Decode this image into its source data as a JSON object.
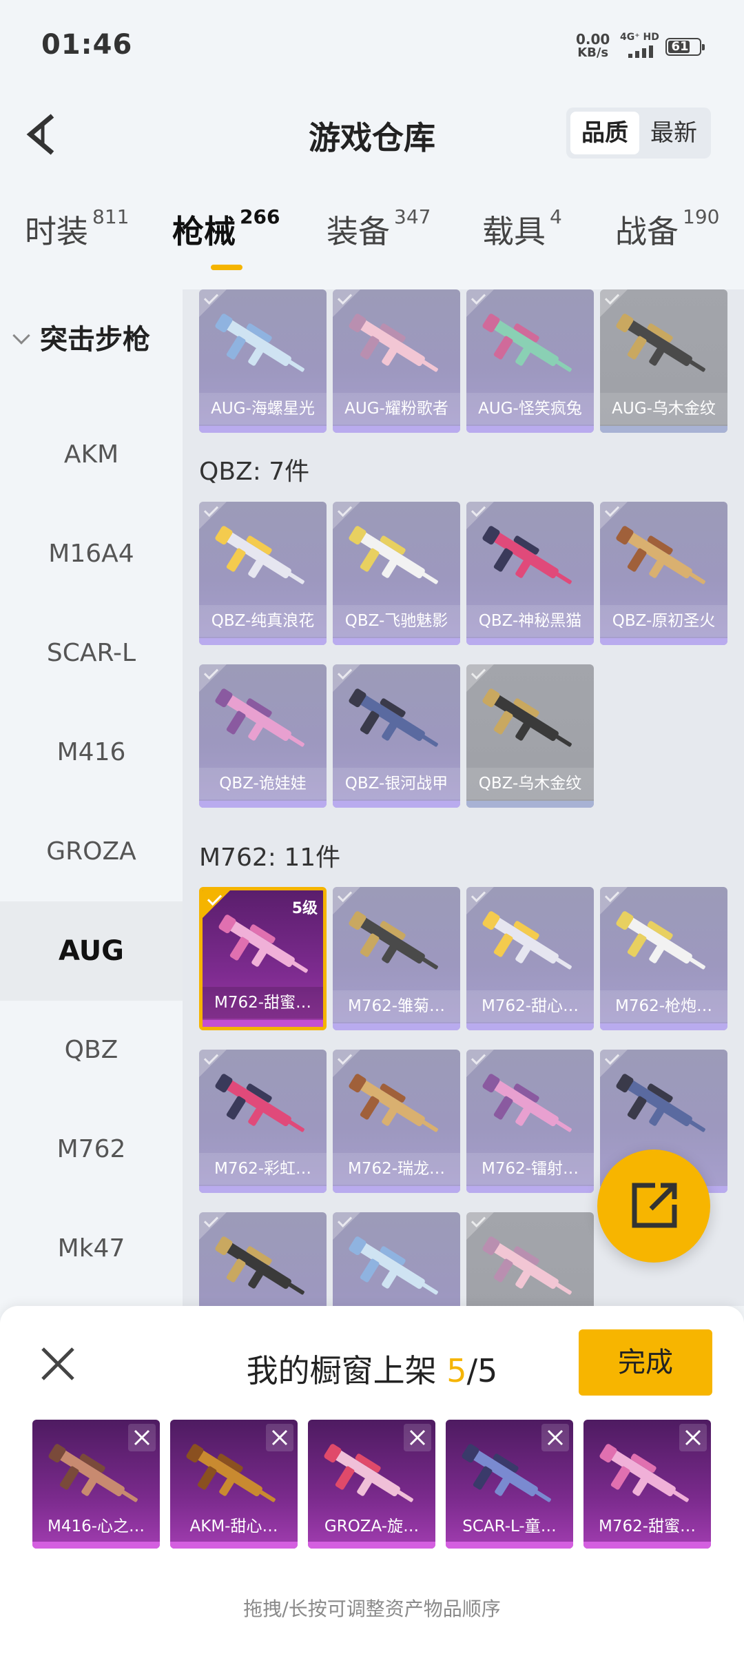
{
  "status": {
    "time": "01:46",
    "net_speed": "0.00",
    "net_unit": "KB/s",
    "signal_label": "4G⁺ HD",
    "battery": "61"
  },
  "header": {
    "title": "游戏仓库",
    "sort_options": [
      "品质",
      "最新"
    ],
    "sort_selected": "品质"
  },
  "tabs": [
    {
      "label": "时装",
      "count": "811"
    },
    {
      "label": "枪械",
      "count": "266",
      "active": true
    },
    {
      "label": "装备",
      "count": "347"
    },
    {
      "label": "载具",
      "count": "4"
    },
    {
      "label": "战备",
      "count": "190"
    }
  ],
  "sidebar": {
    "group": "突击步枪",
    "items": [
      "AKM",
      "M16A4",
      "SCAR-L",
      "M416",
      "GROZA",
      "AUG",
      "QBZ",
      "M762",
      "Mk47"
    ],
    "active": "AUG"
  },
  "sections": [
    {
      "label": "",
      "items": [
        "AUG-海螺星光",
        "AUG-耀粉歌者",
        "AUG-怪笑疯兔",
        "AUG-乌木金纹"
      ]
    },
    {
      "label": "QBZ: 7件",
      "items": [
        "QBZ-纯真浪花",
        "QBZ-飞驰魅影",
        "QBZ-神秘黑猫",
        "QBZ-原初圣火",
        "QBZ-诡娃娃",
        "QBZ-银河战甲",
        "QBZ-乌木金纹"
      ]
    },
    {
      "label": "M762: 11件",
      "items": [
        "M762-甜蜜…",
        "M762-雏菊…",
        "M762-甜心…",
        "M762-枪炮…",
        "M762-彩虹…",
        "M762-瑞龙…",
        "M762-镭射…",
        "",
        "",
        "",
        ""
      ]
    }
  ],
  "selected_card_level": "5级",
  "panel": {
    "title_prefix": "我的橱窗上架 ",
    "count": "5",
    "total": "/5",
    "done_label": "完成",
    "shelf": [
      "M416-心之…",
      "AKM-甜心…",
      "GROZA-旋…",
      "SCAR-L-童…",
      "M762-甜蜜…"
    ],
    "hint": "拖拽/长按可调整资产物品顺序"
  },
  "colors": {
    "accent": "#f5b400",
    "card_purple": "#9d98bf",
    "legendary": "#7d2b8f"
  }
}
